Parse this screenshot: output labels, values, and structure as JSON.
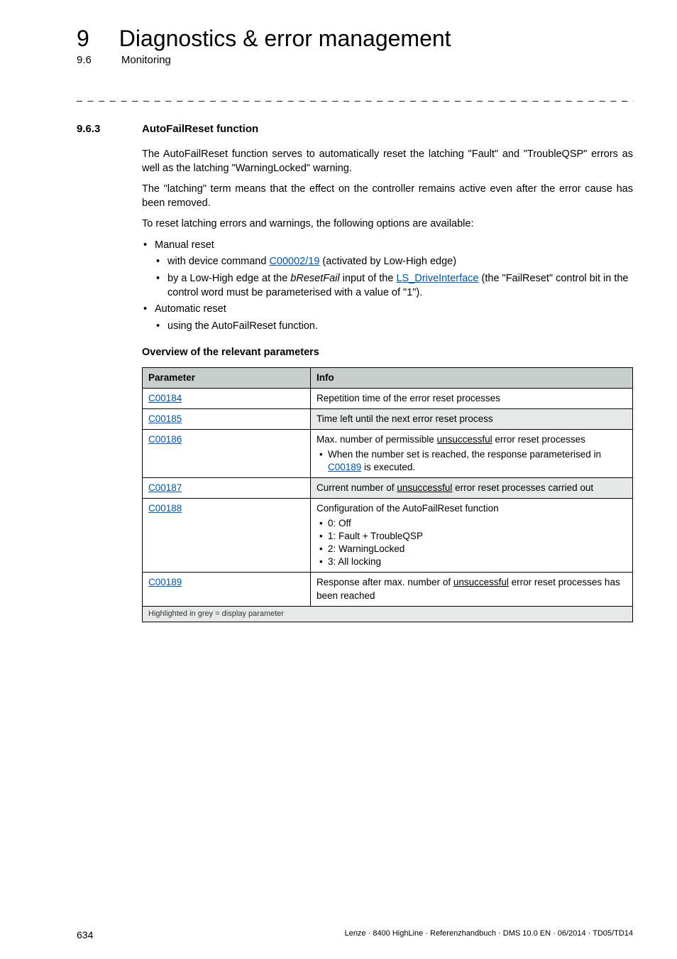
{
  "header": {
    "chapter_number": "9",
    "chapter_title": "Diagnostics & error management",
    "section_number": "9.6",
    "section_title": "Monitoring",
    "dash_rule": "_ _ _ _ _ _ _ _ _ _ _ _ _ _ _ _ _ _ _ _ _ _ _ _ _ _ _ _ _ _ _ _ _ _ _ _ _ _ _ _ _ _ _ _ _ _ _ _ _ _ _ _ _ _ _ _ _ _ _ _ _ _ _ _"
  },
  "subsection": {
    "number": "9.6.3",
    "title": "AutoFailReset function"
  },
  "body": {
    "p1": "The AutoFailReset function serves to automatically reset the latching \"Fault\" and \"TroubleQSP\" errors as well as the latching \"WarningLocked\" warning.",
    "p2": "The \"latching\" term means that the effect on the controller remains active even after the error cause has been removed.",
    "p3": "To reset latching errors and warnings, the following options are available:",
    "li_manual": "Manual reset",
    "li_manual_a_pre": "with device command ",
    "li_manual_a_link": "C00002/19",
    "li_manual_a_post": " (activated by Low-High edge)",
    "li_manual_b_pre": "by a Low-High edge at the ",
    "li_manual_b_ital": "bResetFail",
    "li_manual_b_mid": " input of the ",
    "li_manual_b_link": "LS_DriveInterface",
    "li_manual_b_post": " (the \"FailReset\" control bit in the control word must be parameterised with a value of \"1\").",
    "li_auto": "Automatic reset",
    "li_auto_a": "using the AutoFailReset function.",
    "overview_heading": "Overview of the relevant parameters"
  },
  "table": {
    "head_param": "Parameter",
    "head_info": "Info",
    "rows": {
      "r1": {
        "param": "C00184",
        "info": "Repetition time of the error reset processes"
      },
      "r2": {
        "param": "C00185",
        "info": "Time left until the next error reset process"
      },
      "r3": {
        "param": "C00186",
        "info_pre": "Max. number of permissible ",
        "info_u": "unsuccessful",
        "info_post": " error reset processes",
        "sub_pre": "When the number set is reached, the response parameterised in ",
        "sub_link": "C00189",
        "sub_post": " is executed."
      },
      "r4": {
        "param": "C00187",
        "info_pre": "Current number of ",
        "info_u": "unsuccessful",
        "info_post": " error reset processes carried out"
      },
      "r5": {
        "param": "C00188",
        "info_line": "Configuration of the AutoFailReset function",
        "opts": {
          "o0": "0: Off",
          "o1": "1: Fault + TroubleQSP",
          "o2": "2: WarningLocked",
          "o3": "3: All locking"
        }
      },
      "r6": {
        "param": "C00189",
        "info_pre": "Response after max. number of ",
        "info_u": "unsuccessful",
        "info_post": " error reset processes has been reached"
      }
    },
    "footnote": "Highlighted in grey = display parameter"
  },
  "footer": {
    "page": "634",
    "docinfo": "Lenze · 8400 HighLine · Referenzhandbuch · DMS 10.0 EN · 06/2014 · TD05/TD14"
  }
}
